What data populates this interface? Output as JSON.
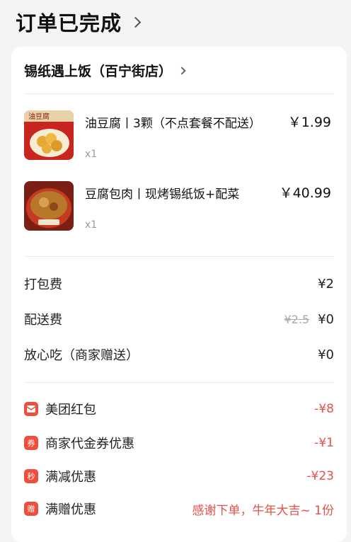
{
  "header": {
    "title": "订单已完成"
  },
  "shop": {
    "name": "锡纸遇上饭（百宁街店）"
  },
  "items": [
    {
      "name": "油豆腐丨3颗（不点套餐不配送）",
      "price": "￥1.99",
      "qty": "x1",
      "thumb_text": "油豆腐"
    },
    {
      "name": "豆腐包肉丨现烤锡纸饭+配菜",
      "price": "￥40.99",
      "qty": "x1"
    }
  ],
  "fees": [
    {
      "label": "打包费",
      "value": "¥2"
    },
    {
      "label": "配送费",
      "original": "¥2.5",
      "value": "¥0"
    },
    {
      "label": "放心吃（商家赠送）",
      "value": "¥0"
    }
  ],
  "promos": [
    {
      "icon": "envelope-icon",
      "icon_text": "",
      "label": "美团红包",
      "value": "-¥8"
    },
    {
      "icon": "coupon-icon",
      "icon_text": "券",
      "label": "商家代金券优惠",
      "value": "-¥1"
    },
    {
      "icon": "discount-icon",
      "icon_text": "秒",
      "label": "满减优惠",
      "value": "-¥23"
    },
    {
      "icon": "gift-icon",
      "icon_text": "赠",
      "label": "满赠优惠",
      "value": "感谢下单，牛年大吉~ 1份"
    }
  ],
  "colors": {
    "accent": "#e2524a",
    "icon_bg": "#ee4e3a"
  }
}
